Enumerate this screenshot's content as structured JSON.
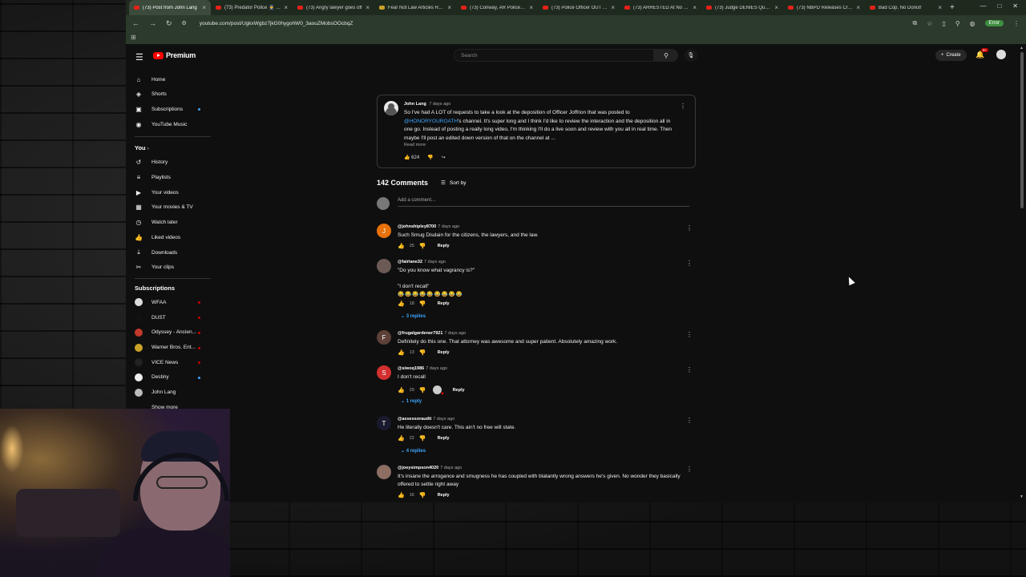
{
  "browser": {
    "tabs": [
      {
        "title": "(73) Post from John Lang",
        "active": true
      },
      {
        "title": "(73) Predator Police 👮 ge"
      },
      {
        "title": "(73) Angry lawyer goes off"
      },
      {
        "title": "Fear Not Law Articles Role",
        "alt": true
      },
      {
        "title": "(73) Conway, AR Police, 4th"
      },
      {
        "title": "(73) Police Officer OUT OF"
      },
      {
        "title": "(73) ARRESTED At No King"
      },
      {
        "title": "(73) Judge DENIES Qualific"
      },
      {
        "title": "(73) NBPD Releases Critica"
      },
      {
        "title": "Bad Cop, No Donut!"
      }
    ],
    "url": "youtube.com/post/UgkxWgbz7jkG0hygohW0_3aouZMobsOOcbqZ",
    "profile_label": "Error"
  },
  "header": {
    "brand": "Premium",
    "search_placeholder": "Search",
    "create_label": "Create",
    "notification_count": "9+"
  },
  "sidebar": {
    "main": [
      {
        "label": "Home",
        "icon": "home-icon",
        "glyph": "⌂"
      },
      {
        "label": "Shorts",
        "icon": "shorts-icon",
        "glyph": "◈"
      },
      {
        "label": "Subscriptions",
        "icon": "subscriptions-icon",
        "glyph": "▣"
      },
      {
        "label": "YouTube Music",
        "icon": "music-icon",
        "glyph": "◉"
      }
    ],
    "you_heading": "You",
    "you_items": [
      {
        "label": "History",
        "icon": "history-icon",
        "glyph": "↺"
      },
      {
        "label": "Playlists",
        "icon": "playlists-icon",
        "glyph": "≡"
      },
      {
        "label": "Your videos",
        "icon": "your-videos-icon",
        "glyph": "▶"
      },
      {
        "label": "Your movies & TV",
        "icon": "movies-icon",
        "glyph": "▦"
      },
      {
        "label": "Watch later",
        "icon": "watch-later-icon",
        "glyph": "◷"
      },
      {
        "label": "Liked videos",
        "icon": "liked-icon",
        "glyph": "👍"
      },
      {
        "label": "Downloads",
        "icon": "download-icon",
        "glyph": "⤓"
      },
      {
        "label": "Your clips",
        "icon": "clips-icon",
        "glyph": "✂"
      }
    ],
    "subscriptions_heading": "Subscriptions",
    "subscriptions": [
      {
        "label": "WFAA",
        "color": "#dddddd",
        "dot": "#cc0000"
      },
      {
        "label": "DUST",
        "color": "#111111",
        "dot": "#cc0000"
      },
      {
        "label": "Odyssey - Ancien...",
        "color": "#c0392b",
        "dot": "#cc0000"
      },
      {
        "label": "Warner Bros. Ent...",
        "color": "#c9a227",
        "dot": "#cc0000"
      },
      {
        "label": "VICE News",
        "color": "#222222",
        "dot": "#cc0000"
      },
      {
        "label": "Destiny",
        "color": "#eeeeee",
        "dot": "#3ea6ff"
      },
      {
        "label": "John Lang",
        "color": "#bbbbbb",
        "dot": null
      },
      {
        "label": "Show more",
        "color": "#0f0f0f",
        "dot": null
      }
    ]
  },
  "post": {
    "author": "John Lang",
    "date": "7 days ago",
    "text_before": "So I've had A LOT of requests to take a look at the deposition of Officer Joffrion that was posted to ",
    "mention": "@HONORYOUROATH",
    "text_after": "'s channel. It's super long and I think I'd like to review the interaction and the deposition all in one go. Instead of posting a really long video, I'm thinking I'll do a live soon and review with you all in real time. Then maybe I'll post an edited down version of that on the channel at ...",
    "read_more": "Read more",
    "likes": "624"
  },
  "comments_section": {
    "count_label": "142 Comments",
    "sort_label": "Sort by",
    "add_placeholder": "Add a comment..."
  },
  "comments": [
    {
      "user": "@johnshipley8700",
      "date": "7 days ago",
      "avatar_letter": "J",
      "avatar_color": "#e8710a",
      "text": "Such Smug Disdain for the citizens, the lawyers, and the law.",
      "likes": "25",
      "reply_label": "Reply",
      "replies": null
    },
    {
      "user": "@fairlane32",
      "date": "7 days ago",
      "avatar_letter": "",
      "avatar_color": "#6b5a55",
      "text": "\"Do you know what vagrancy is?\"",
      "text2": "\"I don't recall\"",
      "emojis": "😂😂😂😂😂😂😂😂😂",
      "likes": "18",
      "reply_label": "Reply",
      "replies": "3 replies"
    },
    {
      "user": "@frugalgardener7921",
      "date": "7 days ago",
      "avatar_letter": "F",
      "avatar_color": "#5d4037",
      "text": "Definitely do this one. That attorney was awesome and super patient. Absolutely amazing work.",
      "likes": "13",
      "reply_label": "Reply",
      "replies": null
    },
    {
      "user": "@siwoq1986",
      "date": "7 days ago",
      "avatar_letter": "S",
      "avatar_color": "#d32f2f",
      "text": "I don't recall",
      "likes": "29",
      "reply_label": "Reply",
      "replies": "1 reply"
    },
    {
      "user": "@assessoraudit",
      "date": "7 days ago",
      "avatar_letter": "T",
      "avatar_color": "#1a1a2e",
      "text": "He literally doesn't care. This ain't no free will state.",
      "likes": "22",
      "reply_label": "Reply",
      "replies": "4 replies"
    },
    {
      "user": "@joeysimpson4020",
      "date": "7 days ago",
      "avatar_letter": "",
      "avatar_color": "#8d6e63",
      "text": "It's insane the arrogance and smugness he has coupled with blatantly wrong answers he's given. No wonder they basically offered to settle right away",
      "likes": "16",
      "reply_label": "Reply",
      "replies": null
    }
  ]
}
